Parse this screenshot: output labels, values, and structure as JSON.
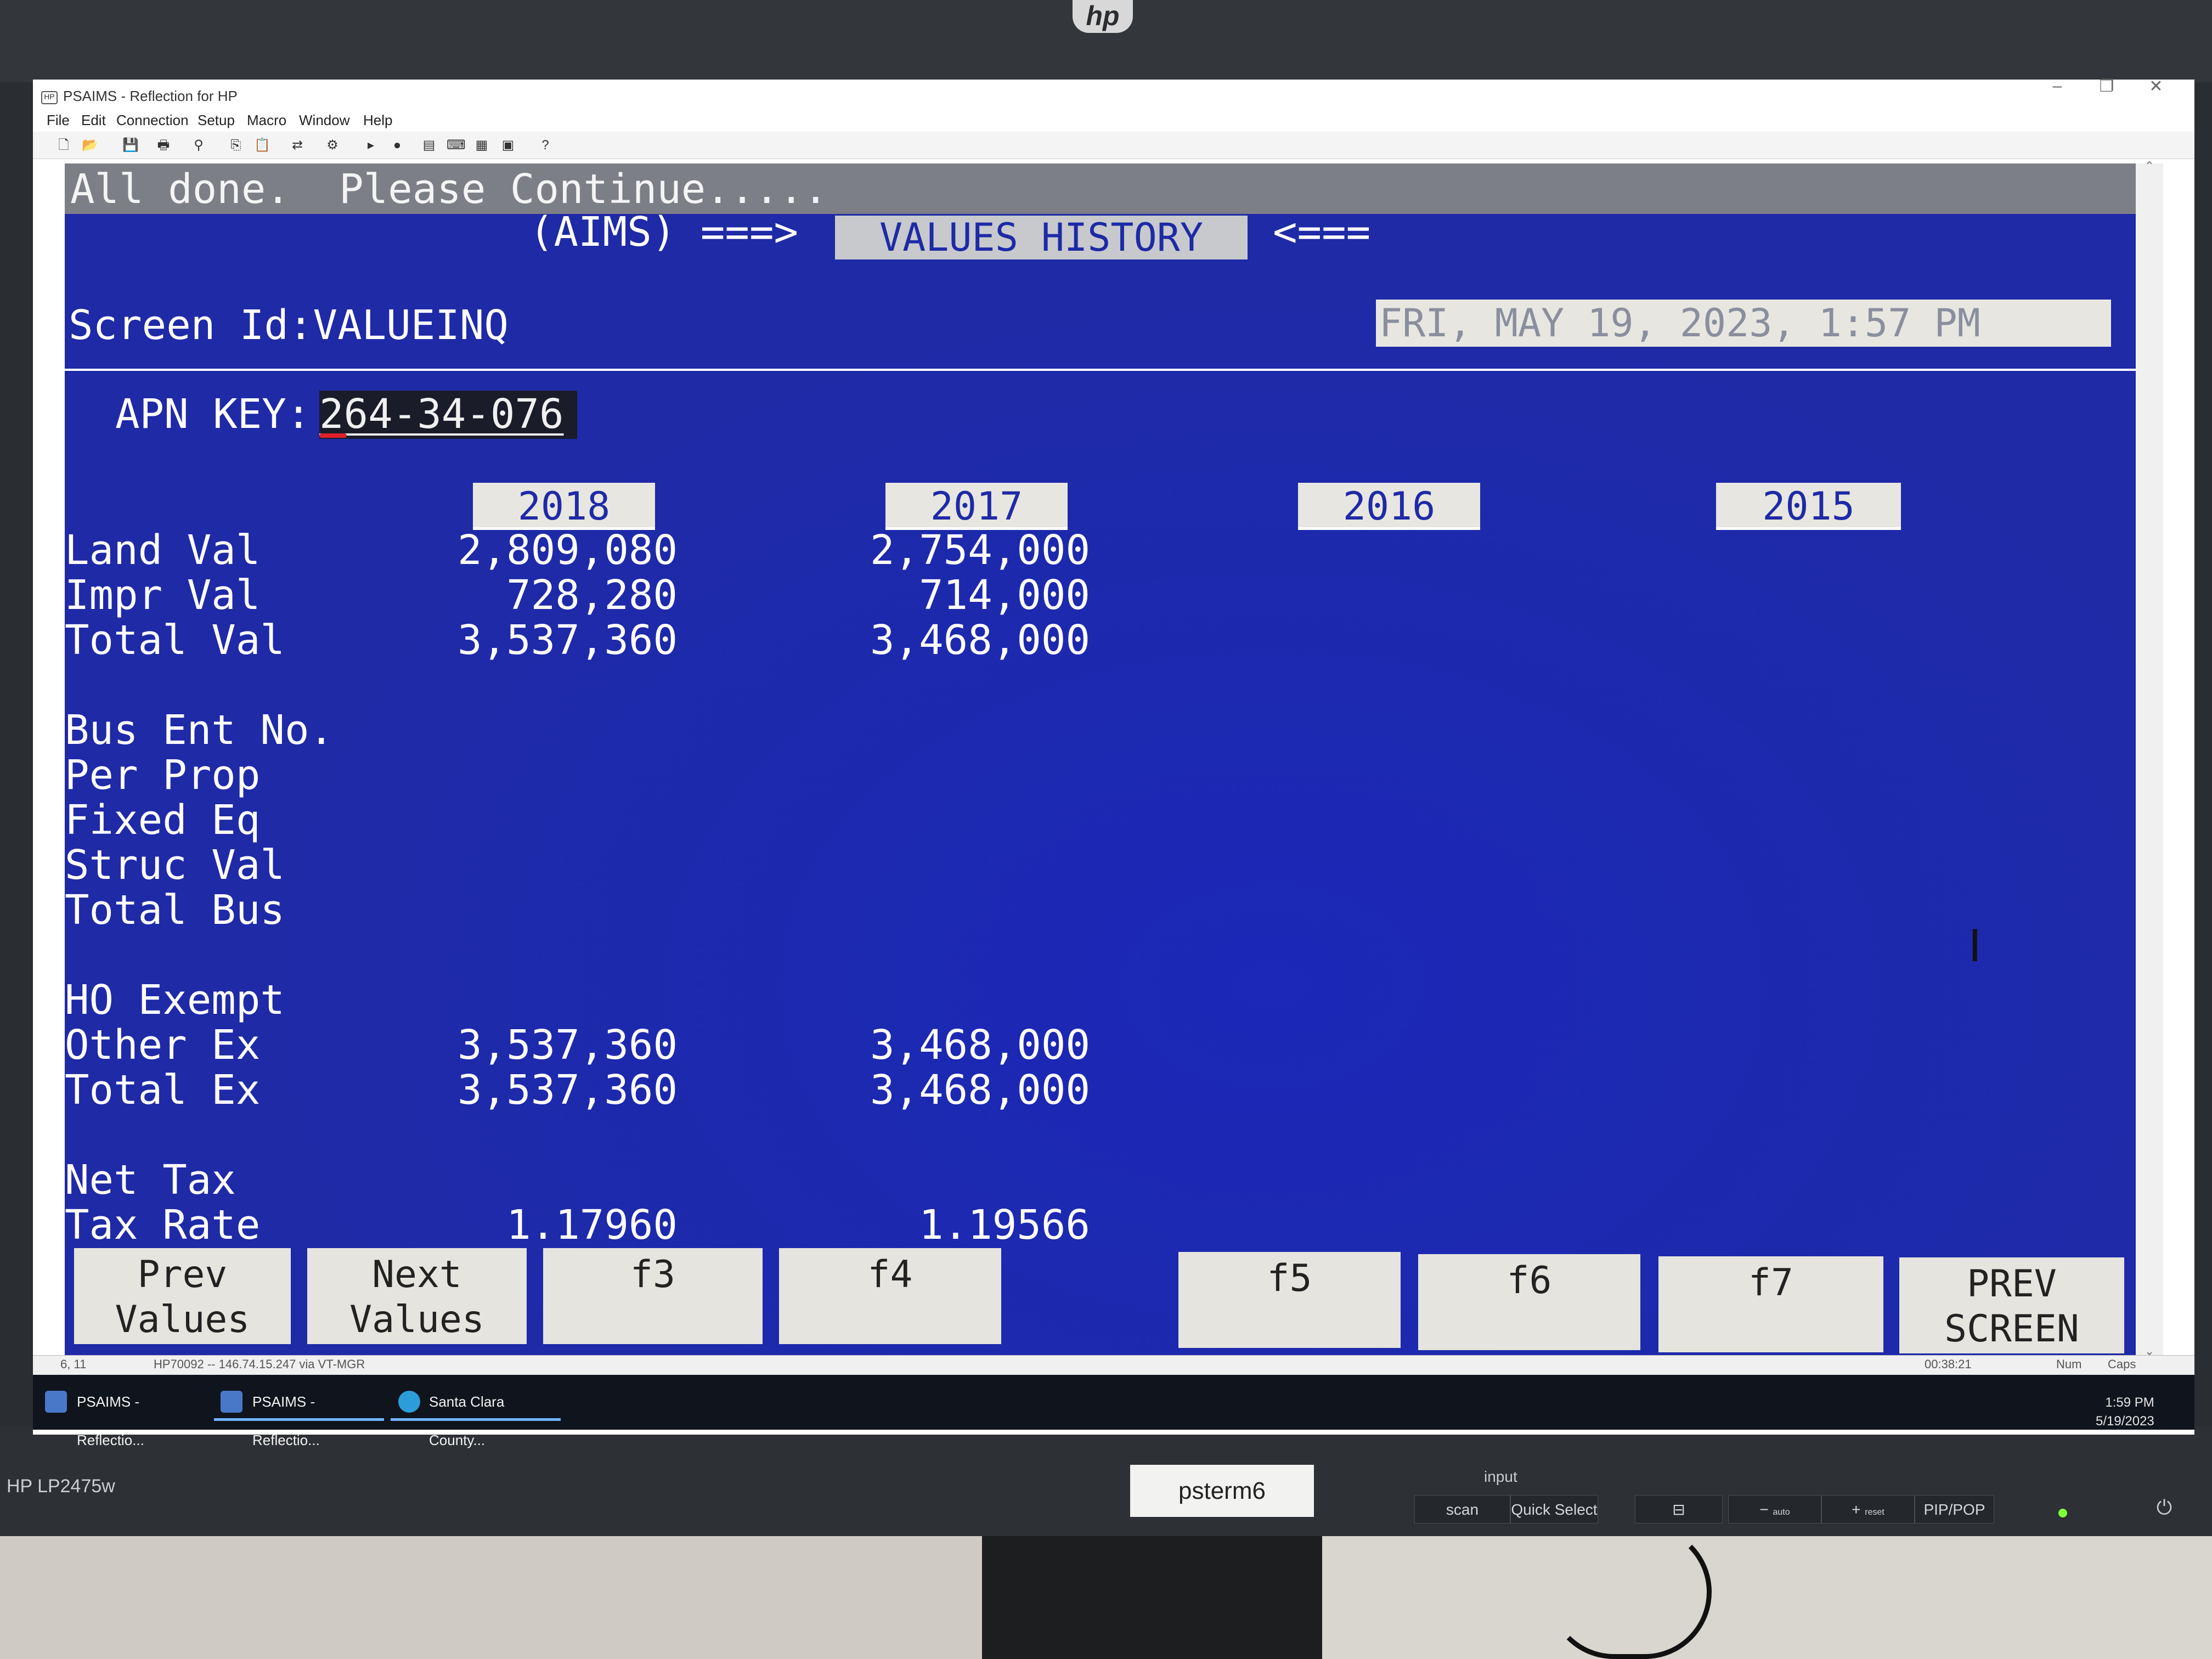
{
  "monitor": {
    "brand_logo": "hp",
    "model": "HP LP2475w",
    "sticker": "psterm6",
    "input_label": "input",
    "buttons": [
      "scan",
      "Quick Select",
      "⊟",
      "−",
      "+",
      "PIP/POP"
    ],
    "button_sublabels": [
      "auto",
      "reset"
    ],
    "power_icon": "power-icon"
  },
  "window": {
    "title": "PSAIMS - Reflection for HP",
    "menu": [
      "File",
      "Edit",
      "Connection",
      "Setup",
      "Macro",
      "Window",
      "Help"
    ],
    "controls": [
      "–",
      "❐",
      "✕"
    ]
  },
  "terminal": {
    "status_message": "All done.  Please Continue.....",
    "header_left": "(AIMS) ===>",
    "header_title": "VALUES HISTORY",
    "header_right": "<===",
    "screen_id": "Screen Id:VALUEINQ",
    "datetime": "FRI, MAY 19, 2023,   1:57 PM",
    "apn_label": "APN KEY:",
    "apn_value": "264-34-076",
    "years": [
      "2018",
      "2017",
      "2016",
      "2015"
    ],
    "rows": [
      {
        "label": "Land Val",
        "v2018": "2,809,080",
        "v2017": "2,754,000"
      },
      {
        "label": "Impr Val",
        "v2018": "728,280",
        "v2017": "714,000"
      },
      {
        "label": "Total Val",
        "v2018": "3,537,360",
        "v2017": "3,468,000"
      },
      {
        "label": "Bus Ent No.",
        "v2018": "",
        "v2017": ""
      },
      {
        "label": "Per Prop",
        "v2018": "",
        "v2017": ""
      },
      {
        "label": "Fixed Eq",
        "v2018": "",
        "v2017": ""
      },
      {
        "label": "Struc Val",
        "v2018": "",
        "v2017": ""
      },
      {
        "label": "Total Bus",
        "v2018": "",
        "v2017": ""
      },
      {
        "label": "HO Exempt",
        "v2018": "",
        "v2017": ""
      },
      {
        "label": "Other Ex",
        "v2018": "3,537,360",
        "v2017": "3,468,000"
      },
      {
        "label": "Total Ex",
        "v2018": "3,537,360",
        "v2017": "3,468,000"
      },
      {
        "label": "Net Tax",
        "v2018": "",
        "v2017": ""
      },
      {
        "label": "Tax Rate",
        "v2018": "1.17960",
        "v2017": "1.19566"
      }
    ],
    "fkeys": [
      {
        "line1": "Prev",
        "line2": "Values"
      },
      {
        "line1": "Next",
        "line2": "Values"
      },
      {
        "line1": "f3",
        "line2": ""
      },
      {
        "line1": "f4",
        "line2": ""
      },
      {
        "line1": "f5",
        "line2": ""
      },
      {
        "line1": "f6",
        "line2": ""
      },
      {
        "line1": "f7",
        "line2": ""
      },
      {
        "line1": "PREV",
        "line2": "SCREEN"
      }
    ]
  },
  "statusbar": {
    "cursor_pos": "6, 11",
    "connection": "HP70092 -- 146.74.15.247 via VT-MGR",
    "elapsed": "00:38:21",
    "num": "Num",
    "caps": "Caps"
  },
  "taskbar": {
    "items": [
      "PSAIMS - Reflectio...",
      "PSAIMS - Reflectio...",
      "Santa Clara County..."
    ],
    "time": "1:59 PM",
    "date": "5/19/2023"
  },
  "colors": {
    "terminal_bg": "#1e2aa6",
    "terminal_text": "#ffffff",
    "message_bar": "#7d7f86",
    "highlight_box": "#e8e6e0"
  }
}
